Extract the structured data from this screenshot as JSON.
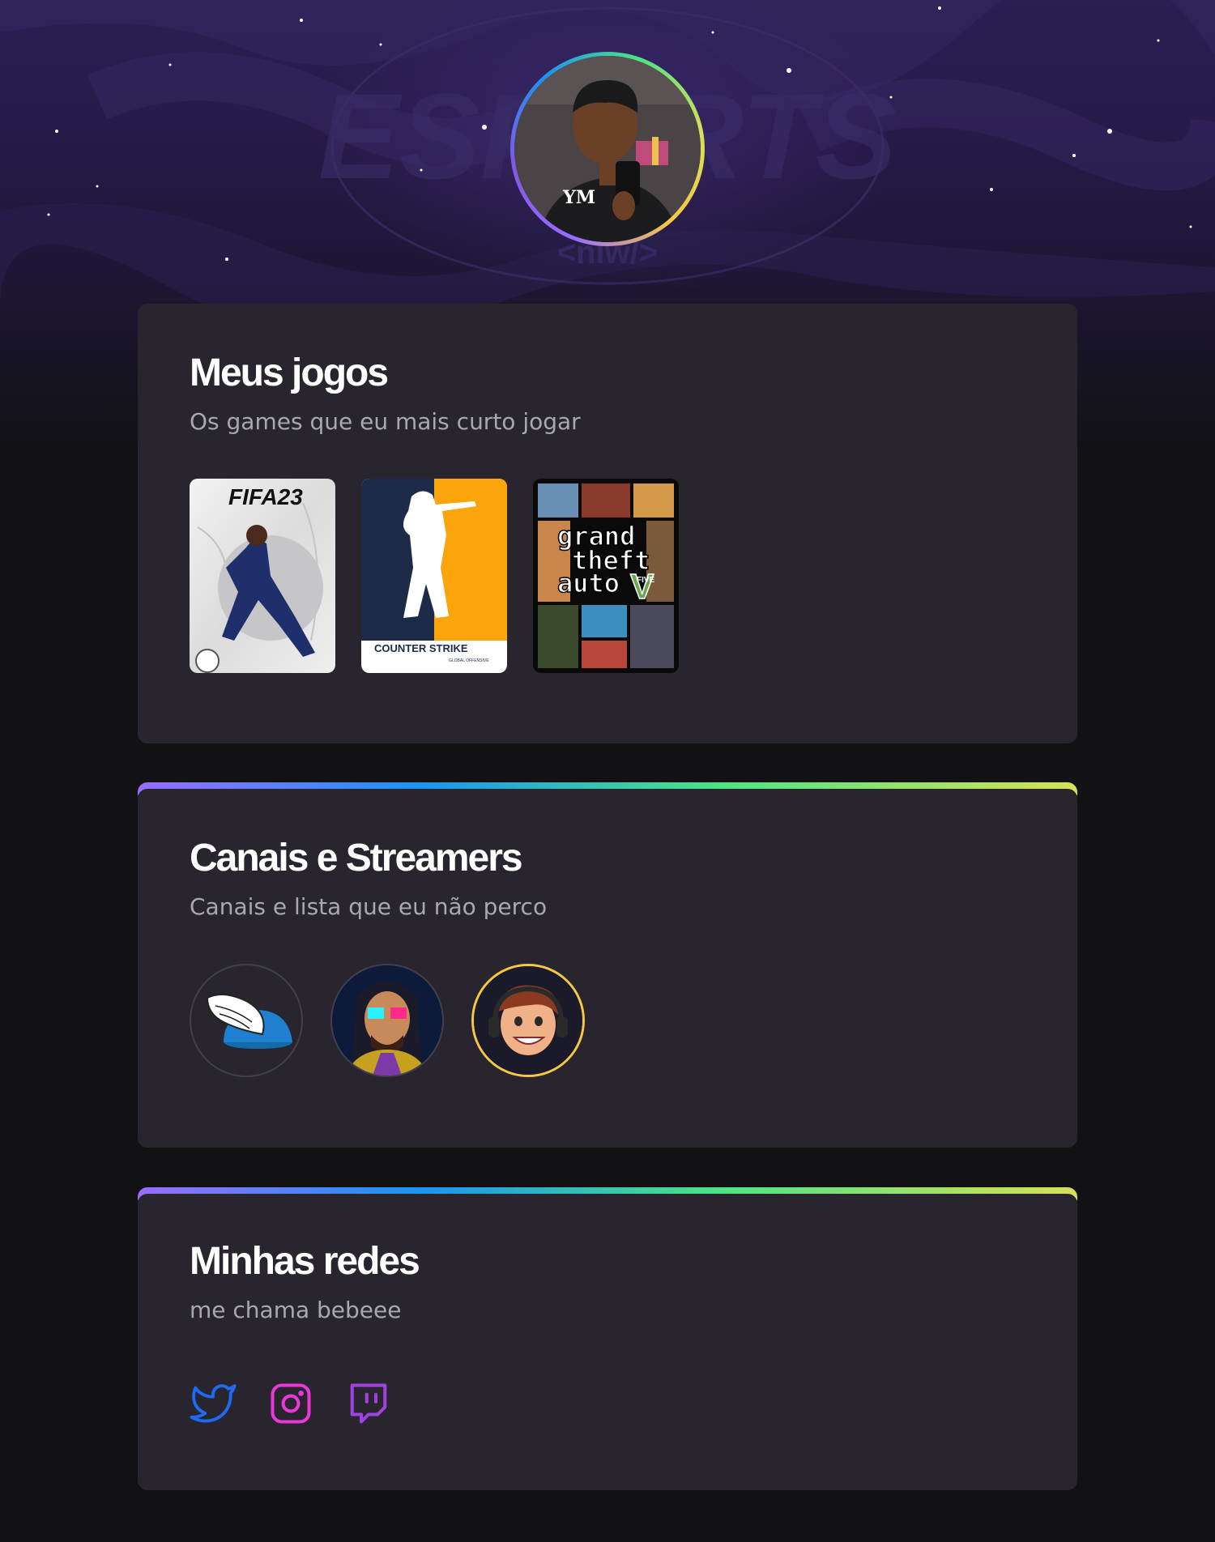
{
  "profile": {
    "avatar_alt": "Foto de perfil",
    "avatar_shirt_text": "YM"
  },
  "hero": {
    "background_logo_text": "ESPORTS",
    "background_tag_text": "<nlw/>"
  },
  "sections": {
    "games": {
      "title": "Meus jogos",
      "subtitle": "Os games que eu mais curto jogar",
      "items": [
        {
          "name": "FIFA 23",
          "cover_text": "FIFA23",
          "icon": "fifa-cover"
        },
        {
          "name": "Counter-Strike: Global Offensive",
          "cover_text": "COUNTER STRIKE",
          "cover_subtext": "GLOBAL OFFENSIVE",
          "icon": "csgo-cover"
        },
        {
          "name": "Grand Theft Auto V",
          "cover_text_1": "grand",
          "cover_text_2": "theft",
          "cover_text_3": "auto",
          "cover_text_4": "FIVE",
          "icon": "gta-cover"
        }
      ]
    },
    "channels": {
      "title": "Canais e Streamers",
      "subtitle": "Canais e lista que eu não perco",
      "items": [
        {
          "name": "Canal com capacete alado",
          "icon": "winged-helmet-avatar"
        },
        {
          "name": "Streamer com óculos",
          "icon": "streamer-glasses-avatar"
        },
        {
          "name": "Streamer com headset",
          "icon": "streamer-headset-avatar"
        }
      ]
    },
    "socials": {
      "title": "Minhas redes",
      "subtitle": "me chama bebeee",
      "items": [
        {
          "name": "Twitter",
          "icon": "twitter-icon",
          "color": "#1d6bf0"
        },
        {
          "name": "Instagram",
          "icon": "instagram-icon",
          "color": "#e838d8"
        },
        {
          "name": "Twitch",
          "icon": "twitch-icon",
          "color": "#a042e0"
        }
      ]
    }
  },
  "colors": {
    "background": "#121214",
    "card": "#29252f",
    "heading": "#ffffff",
    "subtitle": "#a8a8b3",
    "gradient": [
      "#996dff",
      "#1b94f0",
      "#4ee383",
      "#d7e059"
    ]
  }
}
